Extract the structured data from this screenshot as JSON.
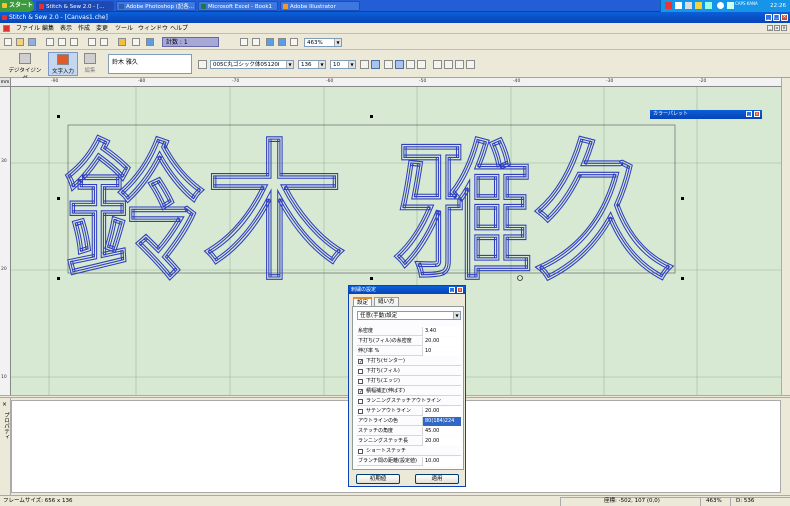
{
  "taskbar": {
    "start_label": "スタート",
    "tasks": [
      {
        "label": "Stitch & Sew 2.0 - [..."
      },
      {
        "label": "Adobe Photoshop (記各..."
      },
      {
        "label": "Microsoft Excel - Book1"
      },
      {
        "label": "Adobe Illustrator"
      }
    ],
    "tray_caption": "CAPS KANA",
    "clock": "22:26"
  },
  "window": {
    "title": "Stitch & Sew 2.0 - [Canvas1.che]"
  },
  "menu": {
    "items": [
      "ファイル",
      "編集",
      "表示",
      "作成",
      "変更",
      "ツール",
      "ウィンドウ",
      "ヘルプ"
    ]
  },
  "toolbar1": {
    "count_label": "計数 : 1",
    "zoom_value": "463%"
  },
  "toolbar2": {
    "digitize_label": "デジタイジング",
    "text_label": "文字入力",
    "edit_label": "編集",
    "text_value": "鈴木 雅久",
    "font_value": "005C丸ゴシック体05120I",
    "size_value": "136",
    "spacing_value": "10"
  },
  "ruler": {
    "top_labels": [
      "-90",
      "-80",
      "-70",
      "-60",
      "-50",
      "-40",
      "-30",
      "-20"
    ],
    "left_labels": [
      "30",
      "20",
      "10"
    ],
    "corner_label": "mm"
  },
  "canvas": {
    "text": "鈴木 雅久",
    "text_color": "#2f3fbf"
  },
  "palette": {
    "title": "カラーパレット"
  },
  "dialog": {
    "title": "刺繍の設定",
    "tabs": [
      "設定",
      "縫い方"
    ],
    "preset": "任意(手動)設定",
    "rows": [
      {
        "label": "糸密度",
        "value": "3.40",
        "type": "value"
      },
      {
        "label": "下打ち(フィル)の糸密度",
        "value": "20.00",
        "type": "value"
      },
      {
        "label": "伸び率 %",
        "value": "10",
        "type": "value"
      },
      {
        "label": "下打ち(センター)",
        "value": "",
        "type": "check",
        "checked": true
      },
      {
        "label": "下打ち(フィル)",
        "value": "",
        "type": "check",
        "checked": false
      },
      {
        "label": "下打ち(エッジ)",
        "value": "",
        "type": "check",
        "checked": false
      },
      {
        "label": "積幅補正(伸ばす)",
        "value": "",
        "type": "check",
        "checked": true
      },
      {
        "label": "ランニングステッチアウトライン",
        "value": "",
        "type": "check",
        "checked": false
      },
      {
        "label": "サテンアウトライン",
        "value": "20.00",
        "type": "check",
        "checked": false
      },
      {
        "label": "アウトラインの色",
        "value": "80(184)224",
        "type": "value",
        "highlight": true
      },
      {
        "label": "ステッチの角度",
        "value": "45.00",
        "type": "value"
      },
      {
        "label": "ランニングステッチ長",
        "value": "20.00",
        "type": "value"
      },
      {
        "label": "ショートステッチ",
        "value": "",
        "type": "check",
        "checked": false
      },
      {
        "label": "ブランチ間の距離(設定値)",
        "value": "10.00",
        "type": "value"
      }
    ],
    "default_button": "初期値",
    "apply_button": "適用"
  },
  "bottom_panel": {
    "tab_label": "プロパティ"
  },
  "status": {
    "frame_size": "フレームサイズ: 656 x 136",
    "position": "座標: -502, 107 (0,0)",
    "zoom": "463%",
    "stitch": "D: 536"
  }
}
